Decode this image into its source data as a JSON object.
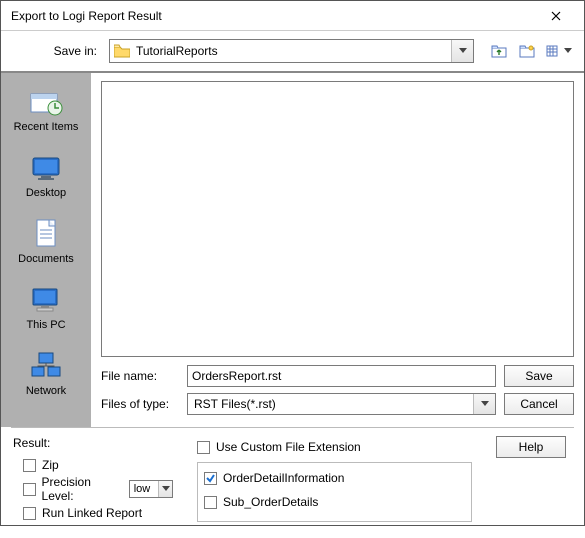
{
  "window": {
    "title": "Export to Logi Report Result"
  },
  "savein": {
    "label": "Save in:",
    "folder": "TutorialReports"
  },
  "sidebar": {
    "items": [
      {
        "label": "Recent Items"
      },
      {
        "label": "Desktop"
      },
      {
        "label": "Documents"
      },
      {
        "label": "This PC"
      },
      {
        "label": "Network"
      }
    ]
  },
  "file": {
    "name_label": "File name:",
    "name_value": "OrdersReport.rst",
    "type_label": "Files of type:",
    "type_value": "RST Files(*.rst)"
  },
  "buttons": {
    "save": "Save",
    "cancel": "Cancel",
    "help": "Help"
  },
  "result": {
    "title": "Result:",
    "zip": "Zip",
    "precision": "Precision Level:",
    "precision_value": "low",
    "runlinked": "Run Linked Report",
    "custom_ext": "Use Custom File Extension",
    "opt1": {
      "label": "OrderDetailInformation",
      "checked": true
    },
    "opt2": {
      "label": "Sub_OrderDetails",
      "checked": false
    }
  }
}
